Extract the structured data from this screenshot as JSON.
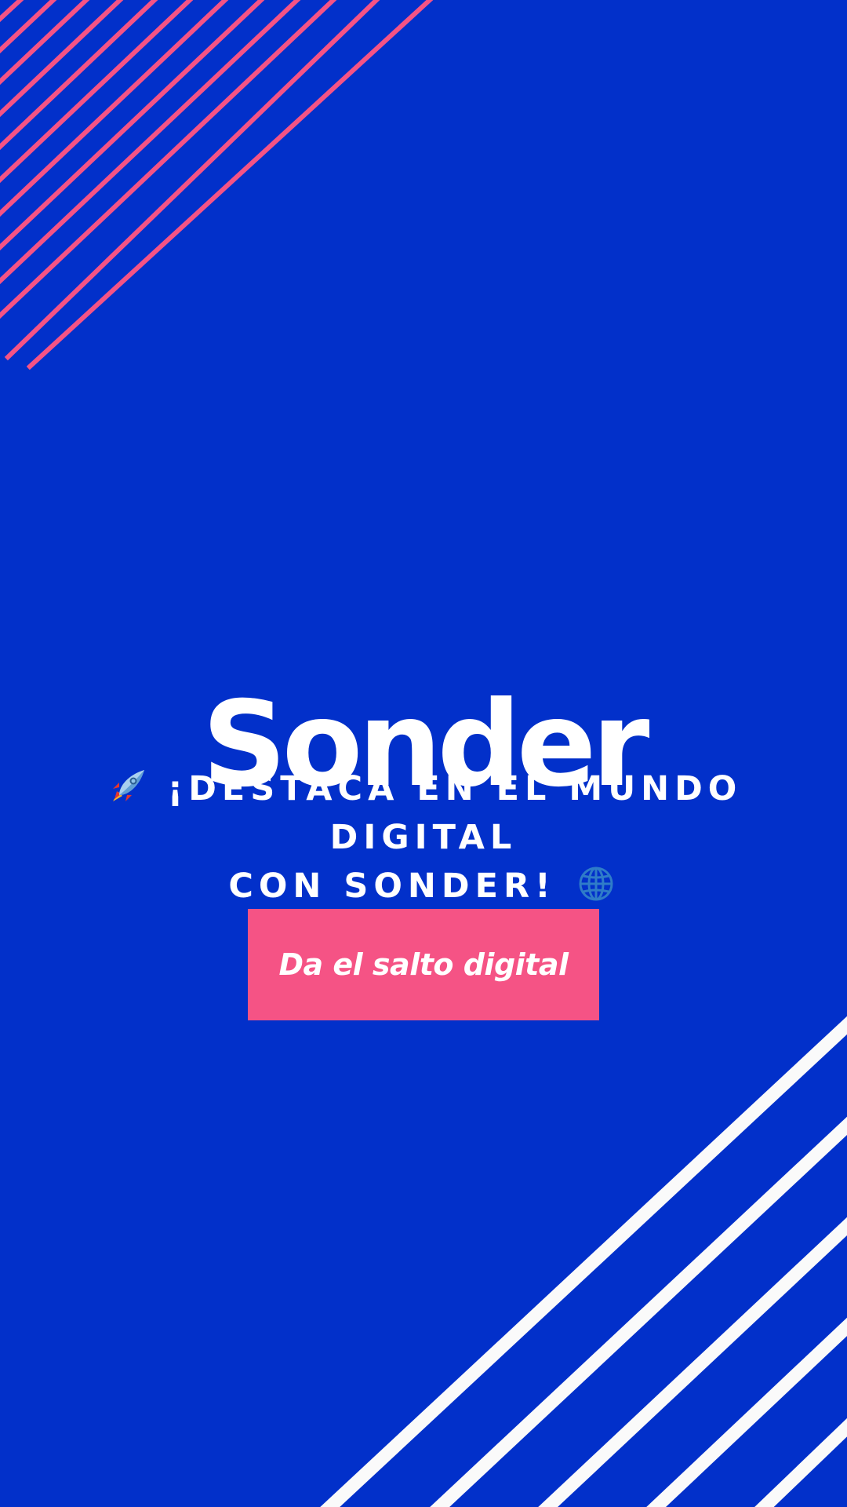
{
  "background_color": "#0230CA",
  "accent_color": "#F55385",
  "stripe_colors": {
    "top_left": "#F55385",
    "bottom_right": "#FFFFFF"
  },
  "hero": {
    "brand": "Sonder",
    "tagline_line1": "¡DESTACA EN EL MUNDO DIGITAL",
    "tagline_line2": "CON SONDER!",
    "leading_icon": "rocket-icon",
    "trailing_icon": "globe-icon"
  },
  "cta": {
    "label": "Da el salto digital"
  }
}
